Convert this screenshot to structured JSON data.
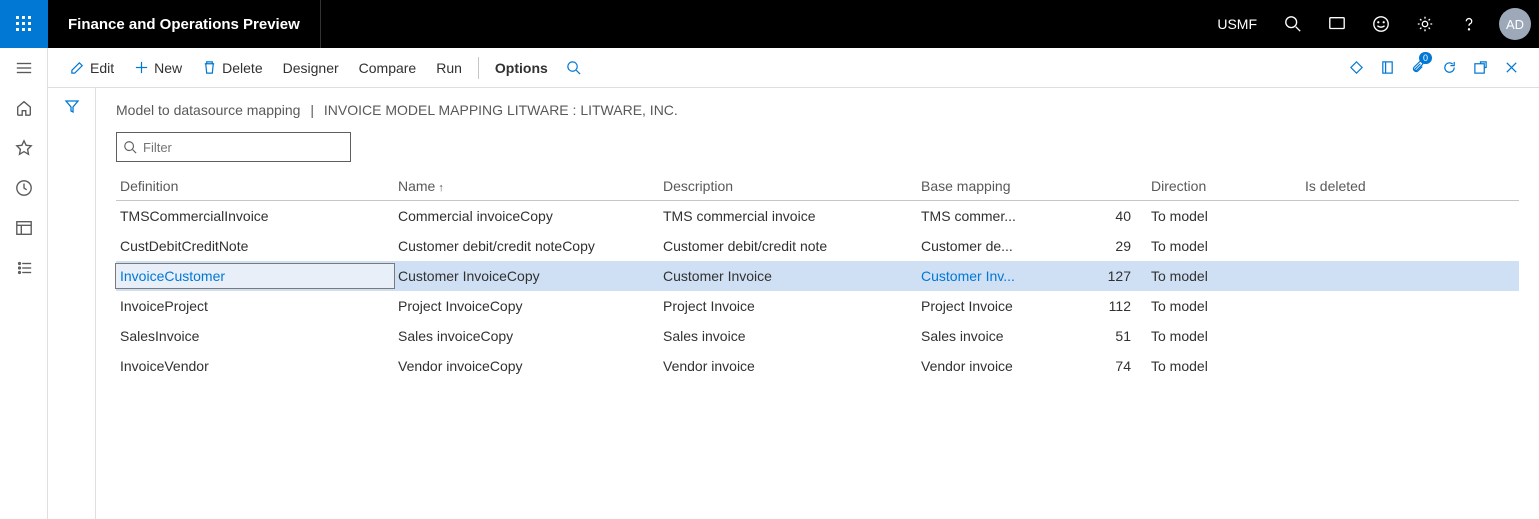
{
  "topbar": {
    "title": "Finance and Operations Preview",
    "company": "USMF",
    "avatar": "AD"
  },
  "commands": {
    "edit": "Edit",
    "new": "New",
    "delete": "Delete",
    "designer": "Designer",
    "compare": "Compare",
    "run": "Run",
    "options": "Options",
    "badge": "0"
  },
  "breadcrumb": {
    "main": "Model to datasource mapping",
    "detail": "INVOICE MODEL MAPPING LITWARE : LITWARE, INC."
  },
  "filter": {
    "placeholder": "Filter"
  },
  "grid": {
    "headers": {
      "definition": "Definition",
      "name": "Name",
      "description": "Description",
      "base": "Base mapping",
      "num": "",
      "direction": "Direction",
      "deleted": "Is deleted"
    },
    "rows": [
      {
        "def": "TMSCommercialInvoice",
        "name": "Commercial invoiceCopy",
        "desc": "TMS commercial invoice",
        "base": "TMS commer...",
        "num": "40",
        "dir": "To model",
        "selected": false
      },
      {
        "def": "CustDebitCreditNote",
        "name": "Customer debit/credit noteCopy",
        "desc": "Customer debit/credit note",
        "base": "Customer de...",
        "num": "29",
        "dir": "To model",
        "selected": false
      },
      {
        "def": "InvoiceCustomer",
        "name": "Customer InvoiceCopy",
        "desc": "Customer Invoice",
        "base": "Customer Inv...",
        "num": "127",
        "dir": "To model",
        "selected": true
      },
      {
        "def": "InvoiceProject",
        "name": "Project InvoiceCopy",
        "desc": "Project Invoice",
        "base": "Project Invoice",
        "num": "112",
        "dir": "To model",
        "selected": false
      },
      {
        "def": "SalesInvoice",
        "name": "Sales invoiceCopy",
        "desc": "Sales invoice",
        "base": "Sales invoice",
        "num": "51",
        "dir": "To model",
        "selected": false
      },
      {
        "def": "InvoiceVendor",
        "name": "Vendor invoiceCopy",
        "desc": "Vendor invoice",
        "base": "Vendor invoice",
        "num": "74",
        "dir": "To model",
        "selected": false
      }
    ]
  }
}
